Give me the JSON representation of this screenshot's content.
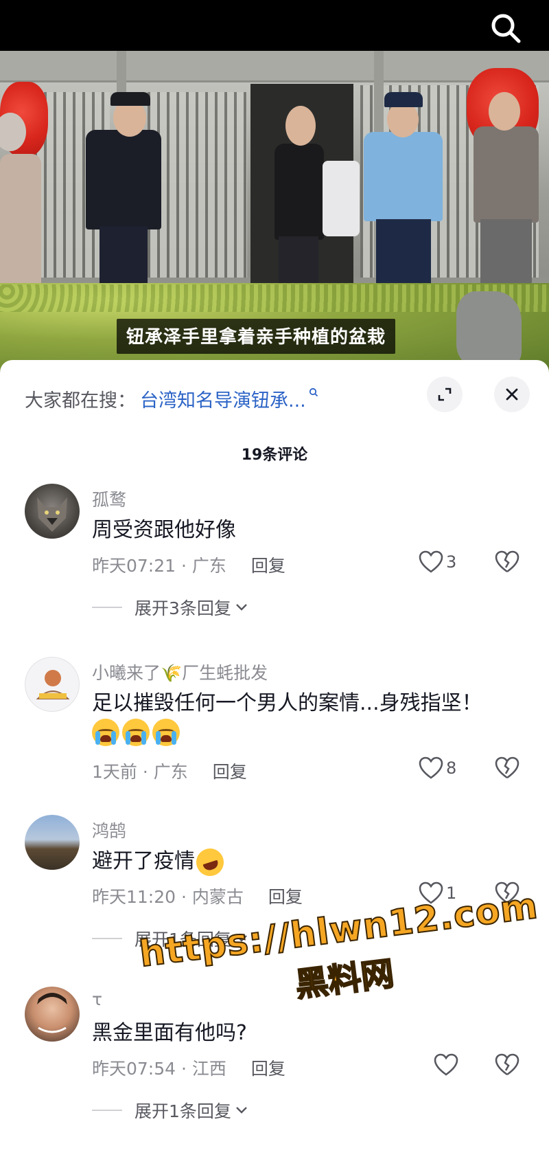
{
  "video": {
    "subtitle": "钮承泽手里拿着亲手种植的盆栽",
    "search_icon": "search-icon"
  },
  "panel": {
    "hot_search_label": "大家都在搜：",
    "hot_search_query": "台湾知名导演钮承...",
    "comment_count": "19条评论",
    "expand_icon": "expand-icon",
    "close_icon": "close-icon"
  },
  "comments": [
    {
      "user": "孤鹜",
      "text": "周受资跟他好像",
      "time": "昨天07:21 · 广东",
      "reply": "回复",
      "likes": "3",
      "expand": "展开3条回复"
    },
    {
      "user": "小曦来了🌾厂生蚝批发",
      "text": "足以摧毁任何一个男人的案情...身残指坚！",
      "time": "1天前 · 广东",
      "reply": "回复",
      "likes": "8",
      "emoji": "crying-emoji"
    },
    {
      "user": "鸿鹄",
      "text": "避开了疫情",
      "time": "昨天11:20 · 内蒙古",
      "reply": "回复",
      "likes": "1",
      "expand": "展开1条回复",
      "emoji": "laughing-emoji"
    },
    {
      "user": "τ",
      "text": "黑金里面有他吗?",
      "time": "昨天07:54 · 江西",
      "reply": "回复",
      "likes": "",
      "expand": "展开1条回复"
    }
  ],
  "watermark": {
    "url": "https://hlwn12.com",
    "name": "黑料网"
  },
  "colors": {
    "link": "#2b63c6",
    "muted": "#8a8b91",
    "text": "#161823",
    "watermark": "#f5a623"
  }
}
